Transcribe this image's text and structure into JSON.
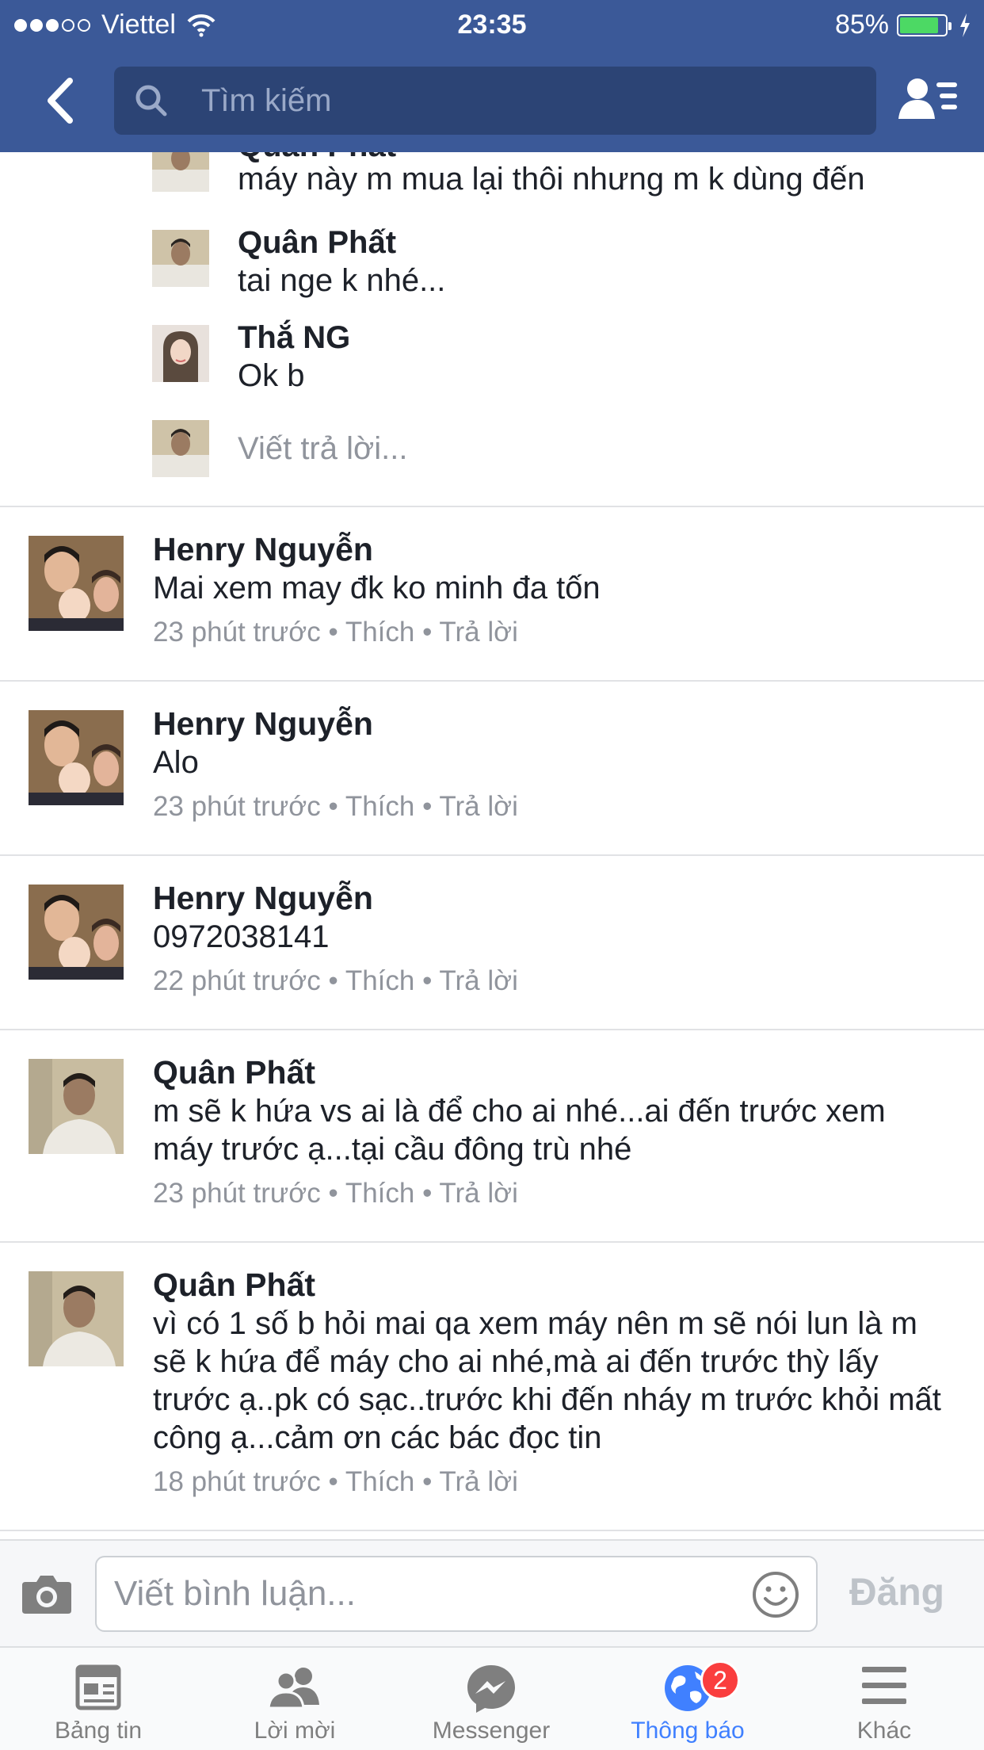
{
  "status_bar": {
    "carrier": "Viettel",
    "time": "23:35",
    "battery": "85%",
    "battery_level": 0.85,
    "signal_bars_filled": 3
  },
  "header": {
    "search_placeholder": "Tìm kiếm",
    "back_icon": "chevron-left-icon",
    "friends_icon": "friend-list-icon"
  },
  "replies": [
    {
      "name": "Quân Phất",
      "text": "máy này m mua lại thôi nhưng m k dùng đến"
    },
    {
      "name": "Quân Phất",
      "text": "tai nge k nhé..."
    },
    {
      "name": "Thắ NG",
      "text": "Ok b"
    }
  ],
  "reply_composer": {
    "placeholder": "Viết trả lời..."
  },
  "comments": [
    {
      "name": "Henry Nguyễn",
      "text": "Mai xem may đk ko minh đa tốn",
      "meta": "23 phút trước • Thích • Trả lời"
    },
    {
      "name": "Henry Nguyễn",
      "text": "Alo",
      "meta": "23 phút trước • Thích • Trả lời"
    },
    {
      "name": "Henry Nguyễn",
      "text": "0972038141",
      "meta": "22 phút trước • Thích • Trả lời"
    },
    {
      "name": "Quân Phất",
      "text": "m sẽ k hứa vs ai là để cho ai nhé...ai đến trước xem máy trước ạ...tại cầu đông trù nhé",
      "meta": "23 phút trước • Thích • Trả lời"
    },
    {
      "name": "Quân Phất",
      "text": "vì có 1 số b hỏi mai qa xem máy nên m sẽ nói lun là m sẽ k hứa để máy cho ai nhé,mà ai đến trước thỳ lấy trước ạ..pk có sạc..trước khi đến nháy m trước khỏi mất công ạ...cảm ơn các bác đọc tin",
      "meta": "18 phút trước • Thích • Trả lời"
    }
  ],
  "composer": {
    "placeholder": "Viết bình luận...",
    "post_label": "Đăng"
  },
  "tabs": [
    {
      "label": "Bảng tin",
      "icon": "news-feed-icon"
    },
    {
      "label": "Lời mời",
      "icon": "friend-requests-icon"
    },
    {
      "label": "Messenger",
      "icon": "messenger-icon"
    },
    {
      "label": "Thông báo",
      "icon": "globe-notifications-icon",
      "badge": "2",
      "active": true
    },
    {
      "label": "Khác",
      "icon": "menu-icon"
    }
  ],
  "colors": {
    "header_bg": "#3b5998",
    "search_bg": "#2c4475",
    "active_tab": "#4080ff",
    "badge": "#fa3e3e",
    "battery_fill": "#4cd964"
  }
}
